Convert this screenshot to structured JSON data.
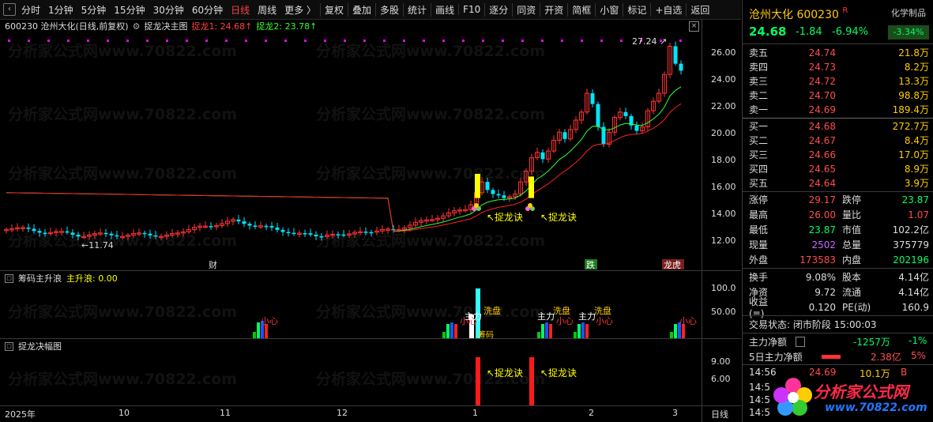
{
  "toolbar": {
    "items": [
      "分时",
      "1分钟",
      "5分钟",
      "15分钟",
      "30分钟",
      "60分钟",
      "日线",
      "周线",
      "更多 〉",
      "复权",
      "叠加",
      "多股",
      "统计",
      "画线",
      "F10",
      "逐分",
      "同资",
      "开资",
      "简框",
      "小窗",
      "标记",
      "+自选",
      "返回"
    ],
    "active": "日线"
  },
  "chart": {
    "header": {
      "code_name": "600230 沧州大化(日线,前复权)",
      "indicator": "捉龙决主图",
      "label1": "捉龙1: 24.68↑",
      "label2": "捉龙2: 23.78↑"
    },
    "max_label": "27.24",
    "min_label": "←11.74",
    "price_axis": [
      "26.00",
      "24.00",
      "22.00",
      "20.00",
      "18.00",
      "16.00",
      "14.00",
      "12.00"
    ],
    "signal_text": "↖捉龙诀",
    "event_tags": {
      "cai": "财",
      "die": "跌",
      "longhu": "龙虎"
    }
  },
  "panel2": {
    "title": "筹码主升浪",
    "value_label": "主升浪: 0.00",
    "axis": [
      "100.0",
      "50.00"
    ],
    "labels": {
      "xiaoxin": "小心",
      "zhuli": "主力",
      "xipan": "洗盘",
      "chouma": "筹码"
    }
  },
  "panel3": {
    "title": "捉龙决幅图",
    "axis": [
      "9.00",
      "6.00"
    ],
    "signal_text": "↖捉龙诀"
  },
  "dates": [
    "2025年",
    "10",
    "11",
    "12",
    "1",
    "2",
    "3",
    "日线"
  ],
  "watermark": "分析家公式网www.70822.com",
  "quote": {
    "name": "沧州大化",
    "code": "600230",
    "flag": "R",
    "price": "24.68",
    "change": "-1.84",
    "pct": "-6.94%",
    "sector": "化学制品",
    "sector_pct": "-3.34%",
    "sells": [
      {
        "k": "卖五",
        "p": "24.74",
        "v": "21.8万"
      },
      {
        "k": "卖四",
        "p": "24.73",
        "v": "8.2万"
      },
      {
        "k": "卖三",
        "p": "24.72",
        "v": "13.3万"
      },
      {
        "k": "卖二",
        "p": "24.70",
        "v": "98.8万"
      },
      {
        "k": "卖一",
        "p": "24.69",
        "v": "189.4万"
      }
    ],
    "buys": [
      {
        "k": "买一",
        "p": "24.68",
        "v": "272.7万"
      },
      {
        "k": "买二",
        "p": "24.67",
        "v": "8.4万"
      },
      {
        "k": "买三",
        "p": "24.66",
        "v": "17.0万"
      },
      {
        "k": "买四",
        "p": "24.65",
        "v": "8.9万"
      },
      {
        "k": "买五",
        "p": "24.64",
        "v": "3.9万"
      }
    ],
    "stats": [
      [
        {
          "k": "涨停",
          "v": "29.17",
          "c": "#ff4d4d"
        },
        {
          "k": "跌停",
          "v": "23.87",
          "c": "#00ff66"
        }
      ],
      [
        {
          "k": "最高",
          "v": "26.00",
          "c": "#ff4d4d"
        },
        {
          "k": "量比",
          "v": "1.07",
          "c": "#ff4d4d"
        }
      ],
      [
        {
          "k": "最低",
          "v": "23.87",
          "c": "#00ff66"
        },
        {
          "k": "市值",
          "v": "102.2亿",
          "c": "#ddd"
        }
      ],
      [
        {
          "k": "现量",
          "v": "2502",
          "c": "#cc66ff"
        },
        {
          "k": "总量",
          "v": "375779",
          "c": "#ddd"
        }
      ],
      [
        {
          "k": "外盘",
          "v": "173583",
          "c": "#ff4d4d"
        },
        {
          "k": "内盘",
          "v": "202196",
          "c": "#00ff66"
        }
      ]
    ],
    "stats2": [
      [
        {
          "k": "换手",
          "v": "9.08%",
          "c": "#ddd"
        },
        {
          "k": "股本",
          "v": "4.14亿",
          "c": "#ddd"
        }
      ],
      [
        {
          "k": "净资",
          "v": "9.72",
          "c": "#ddd"
        },
        {
          "k": "流通",
          "v": "4.14亿",
          "c": "#ddd"
        }
      ],
      [
        {
          "k": "收益(≡)",
          "v": "0.120",
          "c": "#ddd"
        },
        {
          "k": "PE(动)",
          "v": "160.9",
          "c": "#ddd"
        }
      ]
    ],
    "trade_status": "交易状态: 闭市阶段 15:00:03",
    "main_net": {
      "label": "主力净额",
      "value": "-1257万",
      "pct": "-1%"
    },
    "main_net5": {
      "label": "5日主力净额",
      "value": "2.38亿",
      "pct": "5%"
    },
    "tick": {
      "time": "14:56",
      "price": "24.69",
      "vol": "10.1万",
      "flag": "B"
    },
    "tick_times": [
      "14:5",
      "14:5",
      "14:5"
    ],
    "logo_text": "分析家公式网",
    "logo_url": "www.70822.com"
  },
  "colors": {
    "up": "#ff3333",
    "down": "#00e5ff",
    "ma1": "#ff2020",
    "ma2": "#30ff30",
    "yellow": "#ffff00",
    "accent_purple": "#ff00ff"
  }
}
